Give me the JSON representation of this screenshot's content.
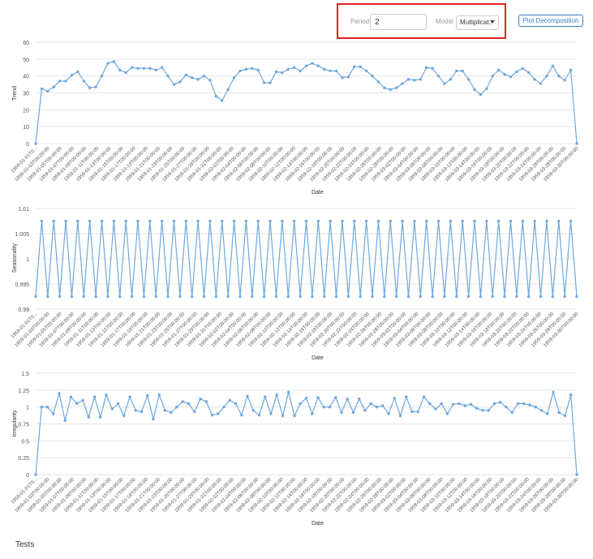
{
  "controls": {
    "period_label": "Period",
    "period_value": "2",
    "model_label": "Model",
    "model_value": "Multiplicat...",
    "plot_button": "Plot Decomposition",
    "highlight_color": "#e02020",
    "button_color": "#3b7dc4"
  },
  "dates": [
    "1959-01-01T0...",
    "1959-01-03T00:00:00",
    "1959-01-05T00:00:00",
    "1959-01-07T00:00:00",
    "1959-01-09T00:00:00",
    "1959-01-11T00:00:00",
    "1959-01-13T00:00:00",
    "1959-01-15T00:00:00",
    "1959-01-17T00:00:00",
    "1959-01-19T00:00:00",
    "1959-01-21T00:00:00",
    "1959-01-23T00:00:00",
    "1959-01-25T00:00:00",
    "1959-01-27T00:00:00",
    "1959-01-29T00:00:00",
    "1959-01-31T00:00:00",
    "1959-02-02T00:00:00",
    "1959-02-04T00:00:00",
    "1959-02-06T00:00:00",
    "1959-02-08T00:00:00",
    "1959-02-10T00:00:00",
    "1959-02-12T00:00:00",
    "1959-02-14T00:00:00",
    "1959-02-16T00:00:00",
    "1959-02-18T00:00:00",
    "1959-02-20T00:00:00",
    "1959-02-22T00:00:00",
    "1959-02-24T00:00:00",
    "1959-02-26T00:00:00",
    "1959-02-28T00:00:00",
    "1959-03-02T00:00:00",
    "1959-03-04T00:00:00",
    "1959-03-06T00:00:00",
    "1959-03-08T00:00:00",
    "1959-03-10T00:00:00",
    "1959-03-12T00:00:00",
    "1959-03-14T00:00:00",
    "1959-03-16T00:00:00",
    "1959-03-18T00:00:00",
    "1959-03-20T00:00:00",
    "1959-03-22T00:00:00",
    "1959-03-24T00:00:00",
    "1959-03-26T00:00:00",
    "1959-03-28T00:00:00",
    "1959-03-30T00:00:00"
  ],
  "chart_data": [
    {
      "type": "line",
      "ylabel": "Trend",
      "xlabel": "Date",
      "ylim": [
        0,
        60
      ],
      "yticks": [
        "0",
        "10",
        "20",
        "30",
        "40",
        "50",
        "60"
      ],
      "grid": true,
      "color": "#6fa8dc",
      "values": [
        0,
        32.5,
        31,
        33.5,
        37,
        37,
        40.5,
        42.5,
        37,
        33,
        33.5,
        40,
        47.5,
        48.5,
        43.5,
        42,
        45,
        44.5,
        44.5,
        44.5,
        43.5,
        45,
        40,
        35,
        36.5,
        40.5,
        39,
        38,
        40,
        37.5,
        28,
        25.5,
        32,
        39,
        43,
        44,
        44.5,
        43.5,
        36,
        36,
        42.5,
        42,
        44,
        45,
        43,
        46,
        47.5,
        46,
        44,
        43,
        43,
        39,
        39.5,
        45.5,
        45.5,
        43,
        40,
        36.5,
        33,
        32,
        33,
        35.5,
        38,
        37.5,
        38,
        45,
        44.5,
        40,
        35.5,
        38,
        43,
        43,
        38,
        32,
        29,
        32.5,
        40,
        43.5,
        41,
        39.5,
        42.5,
        44.5,
        42,
        38,
        35.5,
        40,
        46,
        40,
        37.5,
        43.5,
        0
      ]
    },
    {
      "type": "line",
      "ylabel": "Seasonality",
      "xlabel": "Date",
      "ylim": [
        0.99,
        1.01
      ],
      "yticks": [
        "0.99",
        "0.995",
        "1",
        "1.005",
        "1.01"
      ],
      "grid": true,
      "color": "#6fa8dc",
      "pattern": [
        0.9925,
        1.0075
      ],
      "count": 91
    },
    {
      "type": "line",
      "ylabel": "Irregularity",
      "xlabel": "Date",
      "ylim": [
        0,
        1.5
      ],
      "yticks": [
        "0",
        "0.25",
        "0.5",
        "0.75",
        "1",
        "1.25",
        "1.5"
      ],
      "grid": true,
      "color": "#6fa8dc",
      "values": [
        0,
        1.0,
        1.0,
        0.9,
        1.2,
        0.8,
        1.15,
        1.05,
        1.1,
        0.85,
        1.15,
        0.85,
        1.18,
        0.97,
        1.05,
        0.87,
        1.15,
        0.95,
        0.93,
        1.17,
        0.82,
        1.18,
        0.95,
        0.92,
        1.0,
        1.08,
        1.05,
        0.93,
        1.12,
        1.08,
        0.88,
        0.9,
        1.0,
        1.1,
        1.05,
        0.88,
        1.16,
        0.95,
        0.88,
        1.15,
        0.9,
        1.18,
        0.87,
        1.22,
        0.87,
        1.05,
        1.13,
        0.9,
        1.14,
        1.0,
        1.0,
        1.14,
        0.92,
        1.12,
        0.92,
        1.12,
        0.95,
        1.05,
        1.0,
        1.02,
        0.9,
        1.13,
        0.87,
        1.15,
        0.93,
        0.93,
        1.15,
        1.05,
        0.97,
        1.05,
        0.9,
        1.04,
        1.05,
        1.02,
        1.04,
        0.98,
        0.95,
        0.95,
        1.05,
        1.07,
        1.0,
        0.92,
        1.05,
        1.05,
        1.03,
        1.0,
        0.95,
        0.9,
        1.22,
        0.92,
        0.87,
        1.18,
        0
      ]
    }
  ],
  "tests_heading": "Tests"
}
